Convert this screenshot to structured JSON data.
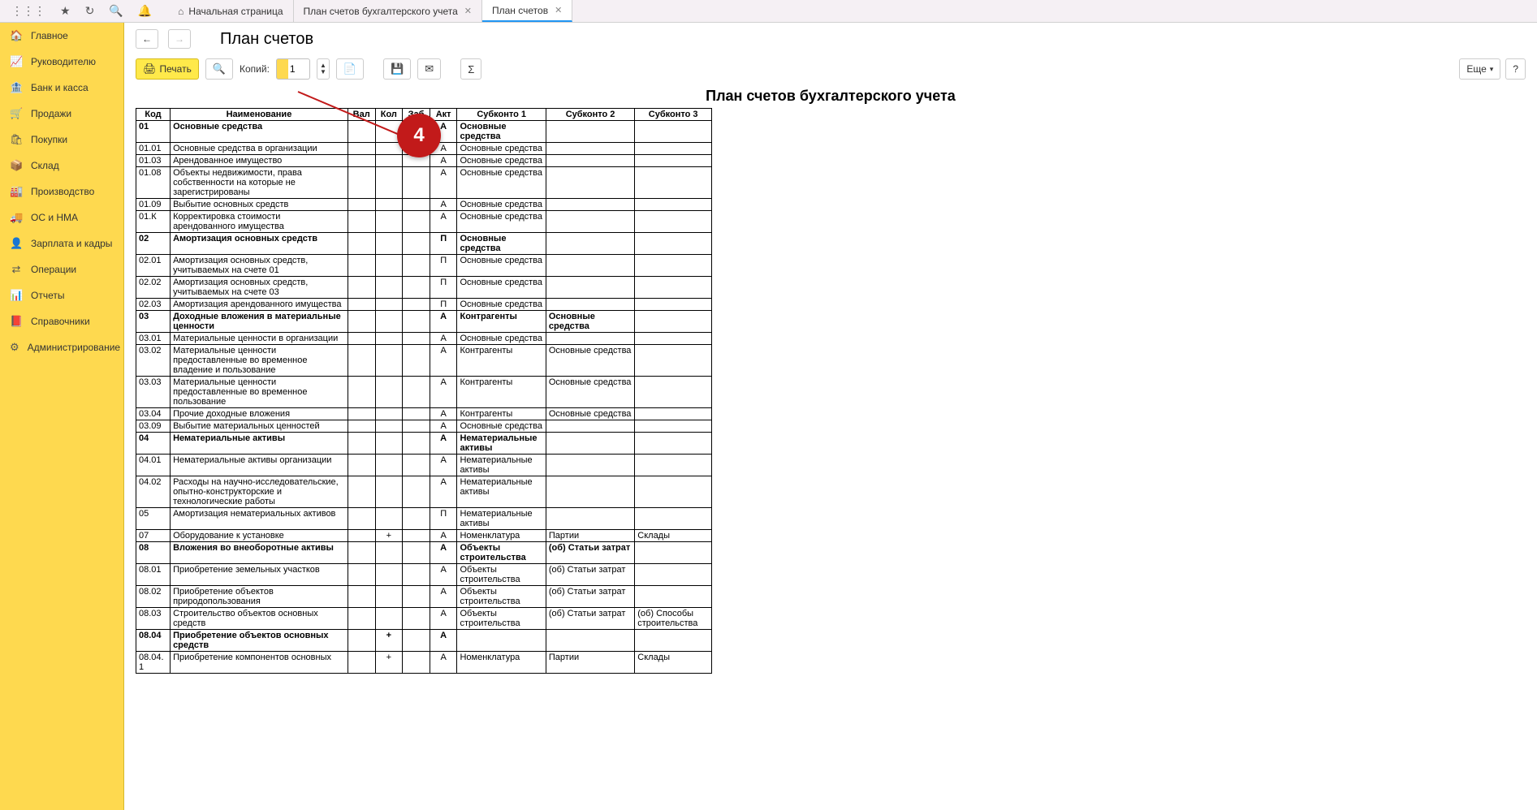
{
  "tabs": [
    {
      "label": "Начальная страница",
      "close": false,
      "home": true
    },
    {
      "label": "План счетов бухгалтерского учета",
      "close": true
    },
    {
      "label": "План счетов",
      "close": true,
      "active": true
    }
  ],
  "sidebar": [
    {
      "ico": "🏠",
      "label": "Главное"
    },
    {
      "ico": "📈",
      "label": "Руководителю"
    },
    {
      "ico": "🏦",
      "label": "Банк и касса"
    },
    {
      "ico": "🛒",
      "label": "Продажи"
    },
    {
      "ico": "🛍",
      "label": "Покупки"
    },
    {
      "ico": "📦",
      "label": "Склад"
    },
    {
      "ico": "🏭",
      "label": "Производство"
    },
    {
      "ico": "🚚",
      "label": "ОС и НМА"
    },
    {
      "ico": "👤",
      "label": "Зарплата и кадры"
    },
    {
      "ico": "⇄",
      "label": "Операции"
    },
    {
      "ico": "📊",
      "label": "Отчеты"
    },
    {
      "ico": "📕",
      "label": "Справочники"
    },
    {
      "ico": "⚙",
      "label": "Администрирование"
    }
  ],
  "page_title": "План счетов",
  "toolbar": {
    "print": "Печать",
    "copies_label": "Копий:",
    "copies_value": "1",
    "more": "Еще"
  },
  "annotation": "4",
  "report_title": "План счетов бухгалтерского учета",
  "columns": [
    "Код",
    "Наименование",
    "Вал",
    "Кол",
    "Заб",
    "Акт",
    "Субконто 1",
    "Субконто 2",
    "Субконто 3"
  ],
  "rows": [
    {
      "b": 1,
      "c": [
        "01",
        "Основные средства",
        "",
        "",
        "",
        "А",
        "Основные средства",
        "",
        ""
      ]
    },
    {
      "c": [
        "01.01",
        "Основные средства в организации",
        "",
        "",
        "",
        "А",
        "Основные средства",
        "",
        ""
      ]
    },
    {
      "c": [
        "01.03",
        "Арендованное имущество",
        "",
        "",
        "",
        "А",
        "Основные средства",
        "",
        ""
      ]
    },
    {
      "c": [
        "01.08",
        "Объекты недвижимости, права собственности на которые не зарегистрированы",
        "",
        "",
        "",
        "А",
        "Основные средства",
        "",
        ""
      ]
    },
    {
      "c": [
        "01.09",
        "Выбытие основных средств",
        "",
        "",
        "",
        "А",
        "Основные средства",
        "",
        ""
      ]
    },
    {
      "c": [
        "01.К",
        "Корректировка стоимости арендованного имущества",
        "",
        "",
        "",
        "А",
        "Основные средства",
        "",
        ""
      ]
    },
    {
      "b": 1,
      "c": [
        "02",
        "Амортизация основных средств",
        "",
        "",
        "",
        "П",
        "Основные средства",
        "",
        ""
      ]
    },
    {
      "c": [
        "02.01",
        "Амортизация основных средств, учитываемых на счете 01",
        "",
        "",
        "",
        "П",
        "Основные средства",
        "",
        ""
      ]
    },
    {
      "c": [
        "02.02",
        "Амортизация основных средств, учитываемых на счете 03",
        "",
        "",
        "",
        "П",
        "Основные средства",
        "",
        ""
      ]
    },
    {
      "c": [
        "02.03",
        "Амортизация арендованного имущества",
        "",
        "",
        "",
        "П",
        "Основные средства",
        "",
        ""
      ]
    },
    {
      "b": 1,
      "c": [
        "03",
        "Доходные вложения в материальные ценности",
        "",
        "",
        "",
        "А",
        "Контрагенты",
        "Основные средства",
        ""
      ]
    },
    {
      "c": [
        "03.01",
        "Материальные ценности в организации",
        "",
        "",
        "",
        "А",
        "Основные средства",
        "",
        ""
      ]
    },
    {
      "c": [
        "03.02",
        "Материальные ценности предоставленные во временное владение и пользование",
        "",
        "",
        "",
        "А",
        "Контрагенты",
        "Основные средства",
        ""
      ]
    },
    {
      "c": [
        "03.03",
        "Материальные ценности предоставленные во временное пользование",
        "",
        "",
        "",
        "А",
        "Контрагенты",
        "Основные средства",
        ""
      ]
    },
    {
      "c": [
        "03.04",
        "Прочие доходные вложения",
        "",
        "",
        "",
        "А",
        "Контрагенты",
        "Основные средства",
        ""
      ]
    },
    {
      "c": [
        "03.09",
        "Выбытие материальных ценностей",
        "",
        "",
        "",
        "А",
        "Основные средства",
        "",
        ""
      ]
    },
    {
      "b": 1,
      "c": [
        "04",
        "Нематериальные активы",
        "",
        "",
        "",
        "А",
        "Нематериальные активы",
        "",
        ""
      ]
    },
    {
      "c": [
        "04.01",
        "Нематериальные активы организации",
        "",
        "",
        "",
        "А",
        "Нематериальные активы",
        "",
        ""
      ]
    },
    {
      "c": [
        "04.02",
        "Расходы на научно-исследовательские, опытно-конструкторские и технологические работы",
        "",
        "",
        "",
        "А",
        "Нематериальные активы",
        "",
        ""
      ]
    },
    {
      "c": [
        "05",
        "Амортизация нематериальных активов",
        "",
        "",
        "",
        "П",
        "Нематериальные активы",
        "",
        ""
      ]
    },
    {
      "c": [
        "07",
        "Оборудование к установке",
        "",
        "+",
        "",
        "А",
        "Номенклатура",
        "Партии",
        "Склады"
      ]
    },
    {
      "b": 1,
      "c": [
        "08",
        "Вложения во внеоборотные активы",
        "",
        "",
        "",
        "А",
        "Объекты строительства",
        "(об) Статьи затрат",
        ""
      ]
    },
    {
      "c": [
        "08.01",
        "Приобретение земельных участков",
        "",
        "",
        "",
        "А",
        "Объекты строительства",
        "(об) Статьи затрат",
        ""
      ]
    },
    {
      "c": [
        "08.02",
        "Приобретение объектов природопользования",
        "",
        "",
        "",
        "А",
        "Объекты строительства",
        "(об) Статьи затрат",
        ""
      ]
    },
    {
      "c": [
        "08.03",
        "Строительство объектов основных средств",
        "",
        "",
        "",
        "А",
        "Объекты строительства",
        "(об) Статьи затрат",
        "(об) Способы строительства"
      ]
    },
    {
      "b": 1,
      "c": [
        "08.04",
        "Приобретение объектов основных средств",
        "",
        "+",
        "",
        "А",
        "",
        "",
        ""
      ]
    },
    {
      "c": [
        "08.04.1",
        "Приобретение компонентов основных",
        "",
        "+",
        "",
        "А",
        "Номенклатура",
        "Партии",
        "Склады"
      ]
    }
  ]
}
